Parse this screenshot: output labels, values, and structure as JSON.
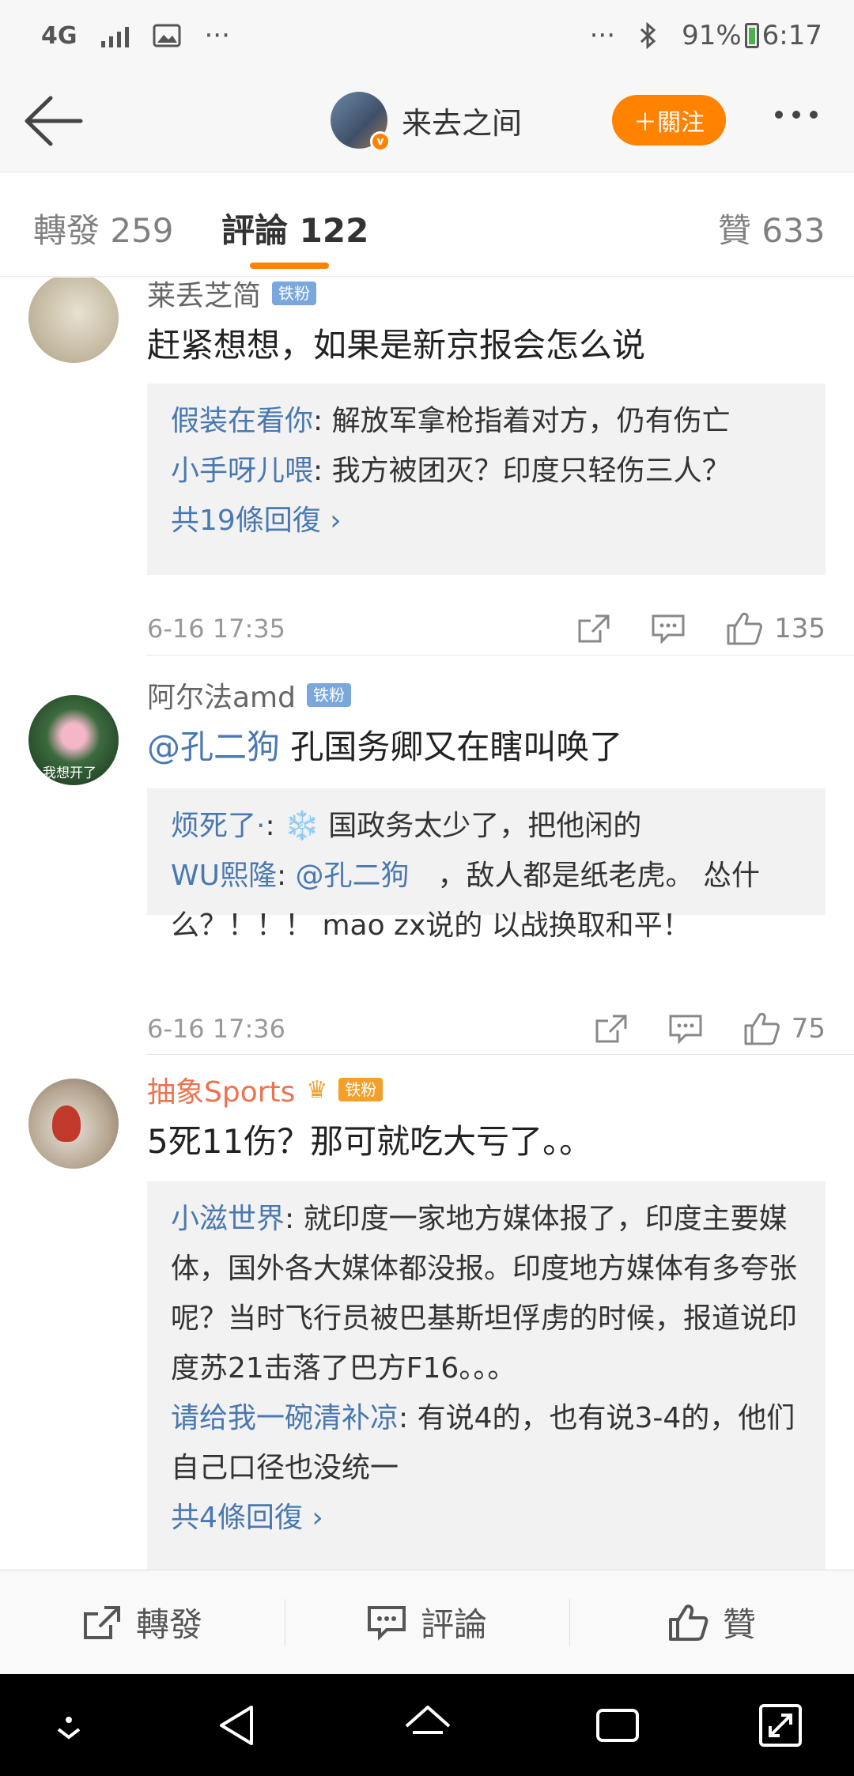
{
  "status_bar": {
    "network": "4G",
    "dots_left": "···",
    "dots_right": "···",
    "battery": "91%",
    "time": "6:17"
  },
  "nav": {
    "title": "来去之间",
    "follow_label": "＋關注"
  },
  "tabs": {
    "repost": "轉發 259",
    "comments": "評論 122",
    "likes": "贊 633"
  },
  "comments": [
    {
      "user": "莱丢芝简",
      "badge": "铁粉",
      "text": "赶紧想想，如果是新京报会怎么说",
      "replies": [
        {
          "name": "假装在看你",
          "text": ": 解放军拿枪指着对方，仍有伤亡"
        },
        {
          "name": "小手呀儿喂",
          "text": ": 我方被团灭？印度只轻伤三人？"
        }
      ],
      "more_replies": "共19條回復 ›",
      "time": "6-16 17:35",
      "likes": "135"
    },
    {
      "user": "阿尔法amd",
      "badge": "铁粉",
      "avatar_caption": "我想开了",
      "mention": "@孔二狗",
      "text": " 孔国务卿又在瞎叫唤了",
      "replies": [
        {
          "name": "烦死了·",
          "text": ": ❄️ 国政务太少了，把他闲的"
        },
        {
          "name": "WU熙隆",
          "text": ": ",
          "mention": "@孔二狗",
          "text2": "　，敌人都是纸老虎。 怂什么？！！！ mao zx说的 以战换取和平！"
        }
      ],
      "time": "6-16 17:36",
      "likes": "75"
    },
    {
      "user": "抽象Sports",
      "badge": "铁粉",
      "text": "5死11伤？那可就吃大亏了。。",
      "replies": [
        {
          "name": "小滋世界",
          "text": ": 就印度一家地方媒体报了，印度主要媒体，国外各大媒体都没报。印度地方媒体有多夸张呢？当时飞行员被巴基斯坦俘虏的时候，报道说印度苏21击落了巴方F16。。。"
        },
        {
          "name": "请给我一碗清补凉",
          "text": ": 有说4的，也有说3-4的，他们自己口径也没统一"
        }
      ],
      "more_replies": "共4條回復 ›"
    }
  ],
  "bottom_bar": {
    "repost": "轉發",
    "comment": "評論",
    "like": "贊"
  },
  "colors": {
    "accent": "#ff8200",
    "link": "#4a78b0"
  }
}
